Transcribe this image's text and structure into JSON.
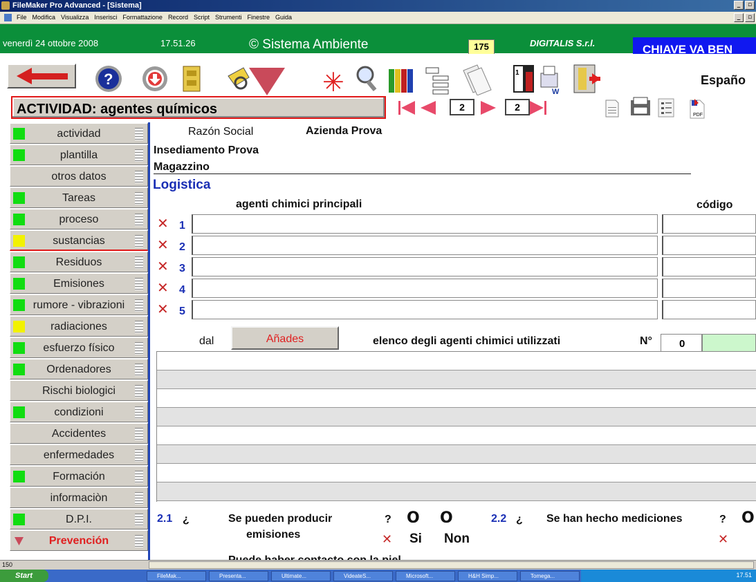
{
  "window": {
    "title": "FileMaker Pro Advanced - [Sistema]"
  },
  "menu": [
    "File",
    "Modifica",
    "Visualizza",
    "Inserisci",
    "Formattazione",
    "Record",
    "Script",
    "Strumenti",
    "Finestre",
    "Guida"
  ],
  "header": {
    "date": "venerdì 24 ottobre 2008",
    "time": "17.51.26",
    "app_name": "© Sistema Ambiente",
    "count": "175",
    "company": "DIGITALIS S.r.l.",
    "key_label": "CHIAVE VA BEN",
    "language": "Españo"
  },
  "page": {
    "title": "ACTIVIDAD: agentes químicos",
    "record_current": "2",
    "record_total": "2"
  },
  "sidebar": {
    "items": [
      {
        "label": "actividad",
        "status": "green"
      },
      {
        "label": "plantilla",
        "status": "green"
      },
      {
        "label": "otros datos",
        "status": "none"
      },
      {
        "label": "Tareas",
        "status": "green"
      },
      {
        "label": "proceso",
        "status": "green"
      },
      {
        "label": "sustancias",
        "status": "yellow"
      },
      {
        "label": "Residuos",
        "status": "green"
      },
      {
        "label": "Emisiones",
        "status": "green"
      },
      {
        "label": "rumore - vibrazioni",
        "status": "green"
      },
      {
        "label": "radiaciones",
        "status": "yellow"
      },
      {
        "label": "esfuerzo físico",
        "status": "green"
      },
      {
        "label": "Ordenadores",
        "status": "green"
      },
      {
        "label": "Rischi biologici",
        "status": "none"
      },
      {
        "label": "condizioni",
        "status": "green"
      },
      {
        "label": "Accidentes",
        "status": "none"
      },
      {
        "label": "enfermedades",
        "status": "none"
      },
      {
        "label": "Formación",
        "status": "green"
      },
      {
        "label": "informaciòn",
        "status": "none"
      },
      {
        "label": "D.P.I.",
        "status": "green"
      },
      {
        "label": "Prevención",
        "status": "red"
      }
    ]
  },
  "content": {
    "razon_label": "Razón Social",
    "razon_value": "Azienda Prova",
    "insediamento": "Insediamento Prova",
    "magazzino": "Magazzino",
    "logistica": "Logistica",
    "agents_header": "agenti chimici principali",
    "code_header": "código",
    "agent_rows": [
      "1",
      "2",
      "3",
      "4",
      "5"
    ],
    "dal_label": "dal",
    "add_button": "Añades",
    "elenco_label": "elenco degli agenti chimici utilizzati",
    "n_label": "N°",
    "n_value": "0",
    "q21_num": "2.1",
    "q21_mark": "¿",
    "q21_text1": "Se pueden producir",
    "q21_text2": "emisiones",
    "q_end": "?",
    "si_label": "Si",
    "non_label": "Non",
    "q22_num": "2.2",
    "q22_mark": "¿",
    "q22_text": "Se han hecho mediciones",
    "q211_text": "Puede haber contacto con la piel"
  },
  "statusbar": {
    "zoom": "150"
  },
  "taskbar": {
    "start": "Start",
    "tasks": [
      "FileMak...",
      "Presenta...",
      "Ultimate...",
      "VideateS...",
      "Microsoft...",
      "H&H Simp...",
      "Tomega..."
    ],
    "clock": "17.51"
  },
  "colors": {
    "header_green": "#0b8f3a",
    "status_green": "#11dd11",
    "status_yellow": "#f2f200",
    "accent_red": "#e01818",
    "key_blue": "#1018f0"
  }
}
